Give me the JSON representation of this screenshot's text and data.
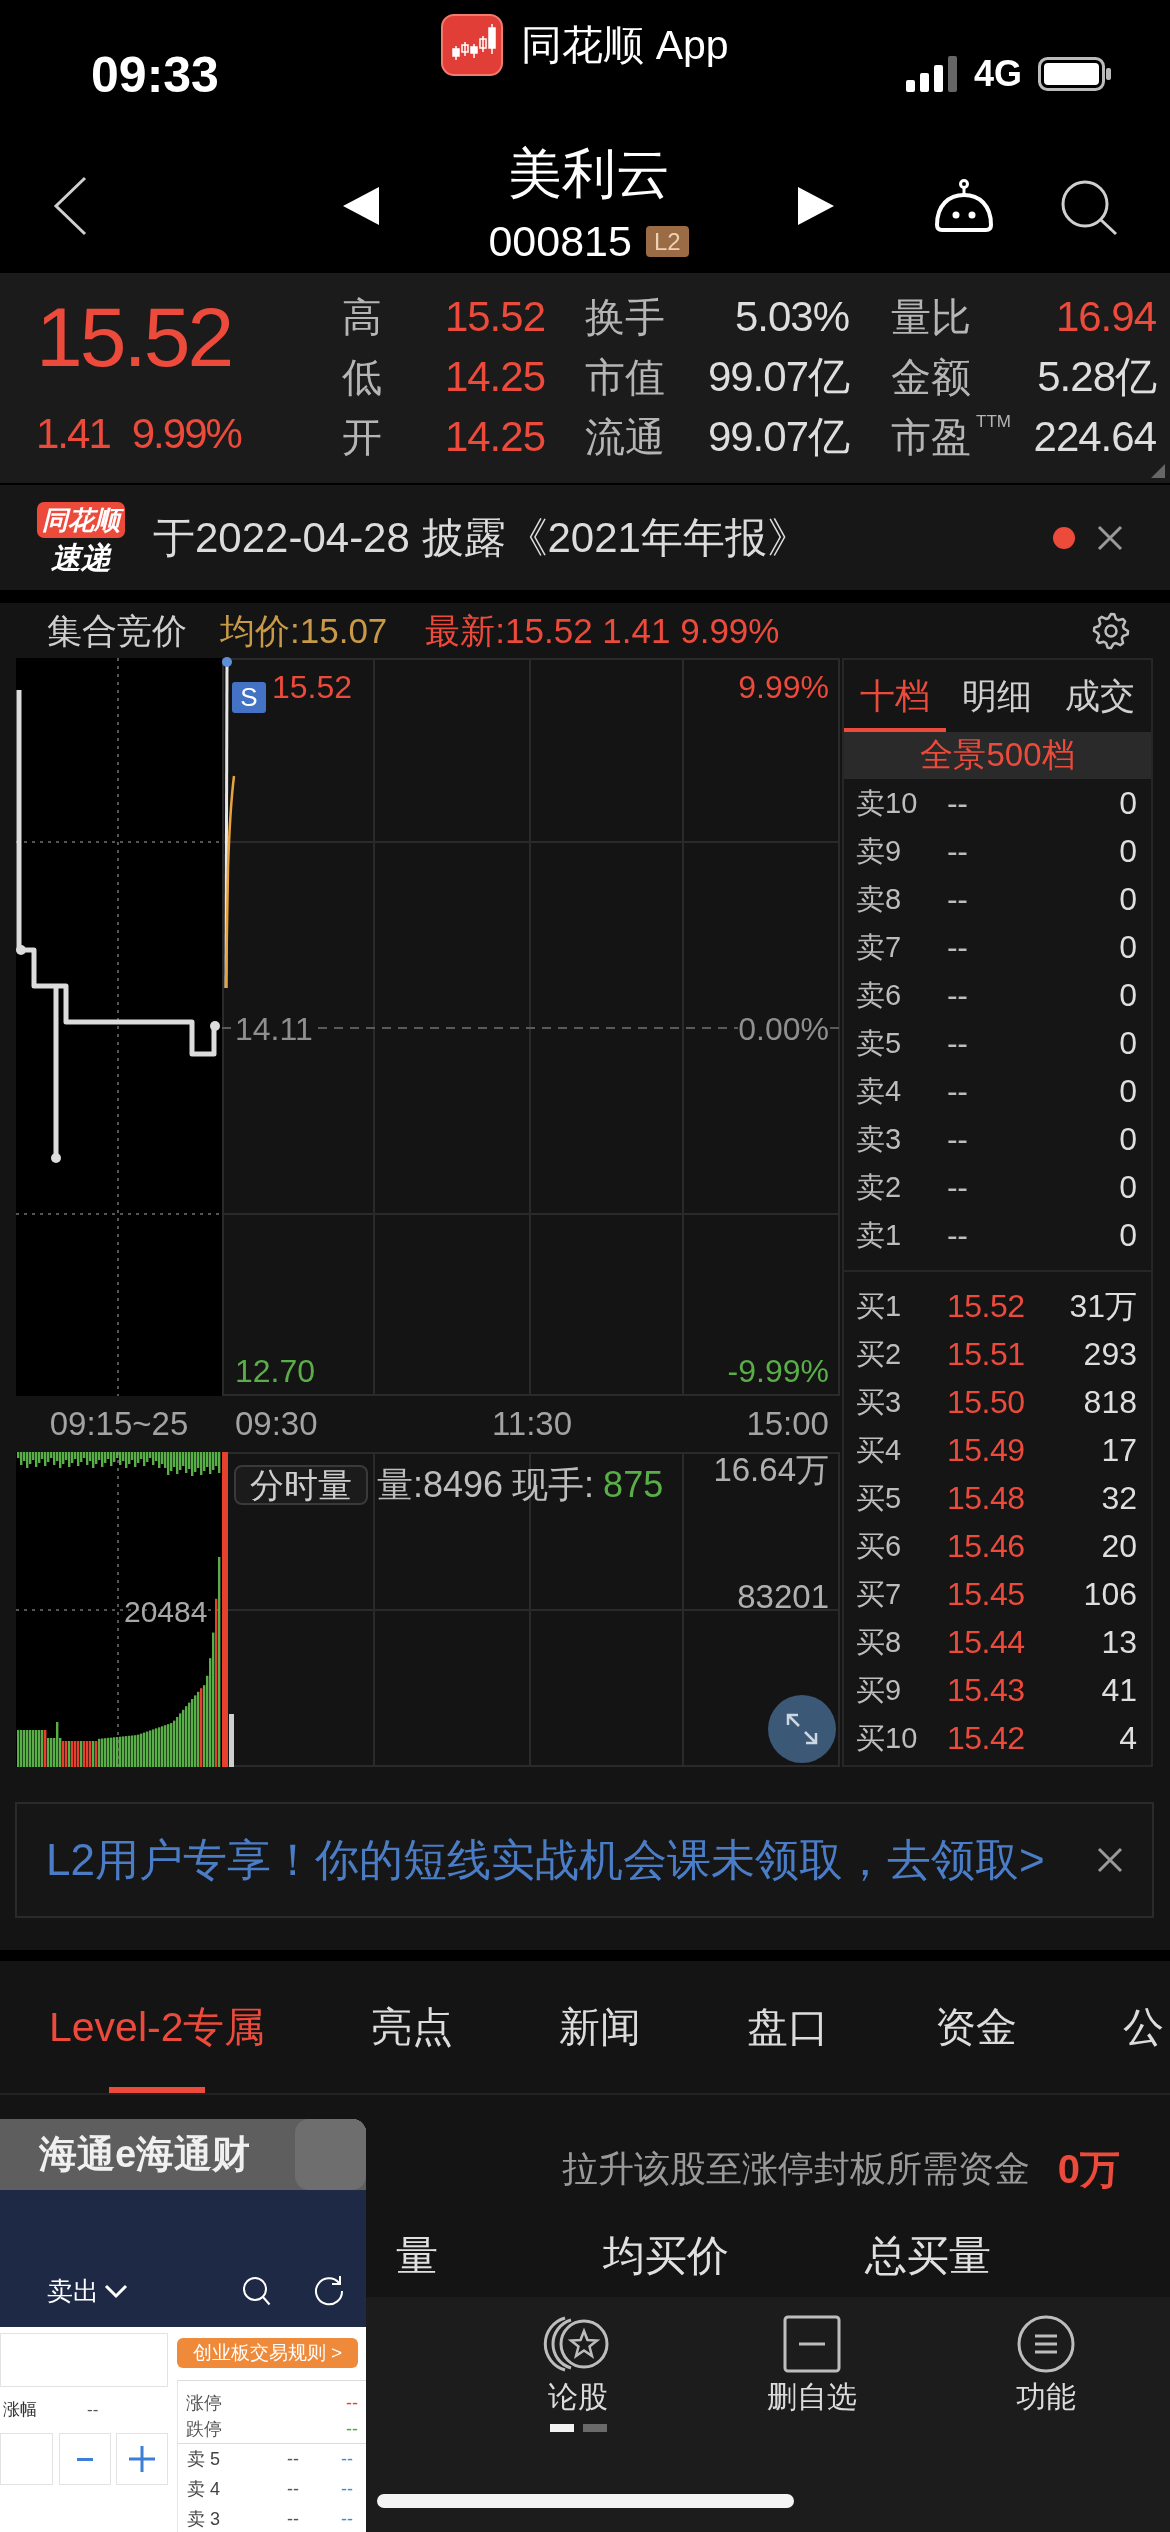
{
  "status_bar": {
    "time": "09:33",
    "app": "同花顺 App",
    "network": "4G"
  },
  "header": {
    "title": "美利云",
    "code": "000815",
    "badge": "L2"
  },
  "quote": {
    "price": "15.52",
    "change": "1.41",
    "change_pct": "9.99%",
    "rows": [
      [
        {
          "label": "高",
          "value": "15.52",
          "kind": "up"
        },
        {
          "label": "换手",
          "value": "5.03%",
          "kind": "plain"
        },
        {
          "label": "量比",
          "value": "16.94",
          "kind": "up"
        }
      ],
      [
        {
          "label": "低",
          "value": "14.25",
          "kind": "up"
        },
        {
          "label": "市值",
          "value": "99.07亿",
          "kind": "plain"
        },
        {
          "label": "金额",
          "value": "5.28亿",
          "kind": "plain"
        }
      ],
      [
        {
          "label": "开",
          "value": "14.25",
          "kind": "up"
        },
        {
          "label": "流通",
          "value": "99.07亿",
          "kind": "plain"
        },
        {
          "label": "市盈$^{TTM}$",
          "value": "224.64",
          "kind": "plain"
        }
      ]
    ]
  },
  "notice": {
    "logo_top": "同花顺",
    "logo_bottom": "速递",
    "text": "于2022-04-28 披露《2021年年报》",
    "unread": true
  },
  "chart_header": {
    "mode": "集合竞价",
    "average": "均价:15.07",
    "latest": "最新:15.52 1.41 9.99%"
  },
  "price_chart": {
    "marker": "S",
    "left_labels": [
      "15.52",
      "14.11",
      "12.70"
    ],
    "right_labels": [
      "9.99%",
      "0.00%",
      "-9.99%"
    ],
    "time_labels": [
      "09:15~25",
      "09:30",
      "11:30",
      "15:00"
    ]
  },
  "volume_chart": {
    "tag": "分时量",
    "volume": "量:8496",
    "current_label": "现手:",
    "current_value": "875",
    "max_label": "16.64万",
    "mid_label": "83201",
    "auction_label": "20484"
  },
  "order_book": {
    "tabs": [
      {
        "label": "十档",
        "selected": true
      },
      {
        "label": "明细",
        "selected": false
      },
      {
        "label": "成交",
        "selected": false
      }
    ],
    "depth_button": "全景500档",
    "asks": [
      {
        "label": "卖10",
        "price": "--",
        "qty": "0"
      },
      {
        "label": "卖9",
        "price": "--",
        "qty": "0"
      },
      {
        "label": "卖8",
        "price": "--",
        "qty": "0"
      },
      {
        "label": "卖7",
        "price": "--",
        "qty": "0"
      },
      {
        "label": "卖6",
        "price": "--",
        "qty": "0"
      },
      {
        "label": "卖5",
        "price": "--",
        "qty": "0"
      },
      {
        "label": "卖4",
        "price": "--",
        "qty": "0"
      },
      {
        "label": "卖3",
        "price": "--",
        "qty": "0"
      },
      {
        "label": "卖2",
        "price": "--",
        "qty": "0"
      },
      {
        "label": "卖1",
        "price": "--",
        "qty": "0"
      }
    ],
    "bids": [
      {
        "label": "买1",
        "price": "15.52",
        "qty": "31万"
      },
      {
        "label": "买2",
        "price": "15.51",
        "qty": "293"
      },
      {
        "label": "买3",
        "price": "15.50",
        "qty": "818"
      },
      {
        "label": "买4",
        "price": "15.49",
        "qty": "17"
      },
      {
        "label": "买5",
        "price": "15.48",
        "qty": "32"
      },
      {
        "label": "买6",
        "price": "15.46",
        "qty": "20"
      },
      {
        "label": "买7",
        "price": "15.45",
        "qty": "106"
      },
      {
        "label": "买8",
        "price": "15.44",
        "qty": "13"
      },
      {
        "label": "买9",
        "price": "15.43",
        "qty": "41"
      },
      {
        "label": "买10",
        "price": "15.42",
        "qty": "4"
      }
    ]
  },
  "banner": {
    "text": "L2用户专享！你的短线实战机会课未领取，去领取>"
  },
  "tabs": [
    {
      "label": "Level-2专属",
      "selected": true
    },
    {
      "label": "亮点",
      "selected": false
    },
    {
      "label": "新闻",
      "selected": false
    },
    {
      "label": "盘口",
      "selected": false
    },
    {
      "label": "资金",
      "selected": false
    },
    {
      "label": "公",
      "selected": false
    }
  ],
  "seal_fund": {
    "label": "拉升该股至涨停封板所需资金",
    "value": "0万"
  },
  "columns": [
    "量",
    "均买价",
    "总买量"
  ],
  "toolbar": {
    "items": [
      {
        "label": "论股",
        "kind": "forum"
      },
      {
        "label": "删自选",
        "kind": "remove"
      },
      {
        "label": "功能",
        "kind": "menu"
      }
    ],
    "pages": [
      {
        "selected": true
      },
      {
        "selected": false
      }
    ]
  },
  "floating_window": {
    "title": "海通e海通财",
    "action": "卖出",
    "rules_button": "创业板交易规则 >",
    "change_label": "涨幅",
    "change_value": "--",
    "limits": [
      {
        "label": "涨停",
        "value": "--",
        "kind": "up"
      },
      {
        "label": "跌停",
        "value": "--",
        "kind": "down"
      }
    ],
    "asks": [
      {
        "label": "卖 5",
        "price": "--",
        "qty": "--"
      },
      {
        "label": "卖 4",
        "price": "--",
        "qty": "--"
      },
      {
        "label": "卖 3",
        "price": "--",
        "qty": "--"
      }
    ]
  }
}
